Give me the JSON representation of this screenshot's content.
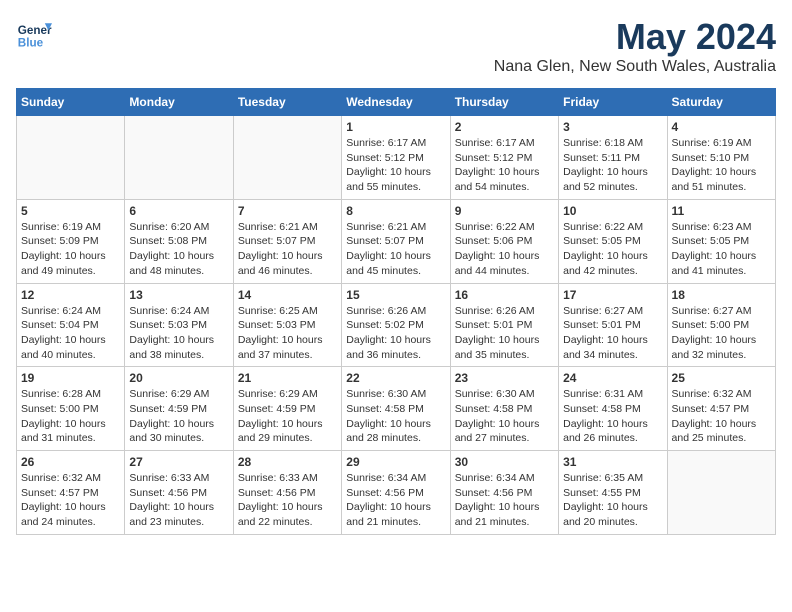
{
  "header": {
    "logo_line1": "General",
    "logo_line2": "Blue",
    "month_year": "May 2024",
    "location": "Nana Glen, New South Wales, Australia"
  },
  "days_of_week": [
    "Sunday",
    "Monday",
    "Tuesday",
    "Wednesday",
    "Thursday",
    "Friday",
    "Saturday"
  ],
  "weeks": [
    [
      {
        "day": "",
        "info": ""
      },
      {
        "day": "",
        "info": ""
      },
      {
        "day": "",
        "info": ""
      },
      {
        "day": "1",
        "info": "Sunrise: 6:17 AM\nSunset: 5:12 PM\nDaylight: 10 hours\nand 55 minutes."
      },
      {
        "day": "2",
        "info": "Sunrise: 6:17 AM\nSunset: 5:12 PM\nDaylight: 10 hours\nand 54 minutes."
      },
      {
        "day": "3",
        "info": "Sunrise: 6:18 AM\nSunset: 5:11 PM\nDaylight: 10 hours\nand 52 minutes."
      },
      {
        "day": "4",
        "info": "Sunrise: 6:19 AM\nSunset: 5:10 PM\nDaylight: 10 hours\nand 51 minutes."
      }
    ],
    [
      {
        "day": "5",
        "info": "Sunrise: 6:19 AM\nSunset: 5:09 PM\nDaylight: 10 hours\nand 49 minutes."
      },
      {
        "day": "6",
        "info": "Sunrise: 6:20 AM\nSunset: 5:08 PM\nDaylight: 10 hours\nand 48 minutes."
      },
      {
        "day": "7",
        "info": "Sunrise: 6:21 AM\nSunset: 5:07 PM\nDaylight: 10 hours\nand 46 minutes."
      },
      {
        "day": "8",
        "info": "Sunrise: 6:21 AM\nSunset: 5:07 PM\nDaylight: 10 hours\nand 45 minutes."
      },
      {
        "day": "9",
        "info": "Sunrise: 6:22 AM\nSunset: 5:06 PM\nDaylight: 10 hours\nand 44 minutes."
      },
      {
        "day": "10",
        "info": "Sunrise: 6:22 AM\nSunset: 5:05 PM\nDaylight: 10 hours\nand 42 minutes."
      },
      {
        "day": "11",
        "info": "Sunrise: 6:23 AM\nSunset: 5:05 PM\nDaylight: 10 hours\nand 41 minutes."
      }
    ],
    [
      {
        "day": "12",
        "info": "Sunrise: 6:24 AM\nSunset: 5:04 PM\nDaylight: 10 hours\nand 40 minutes."
      },
      {
        "day": "13",
        "info": "Sunrise: 6:24 AM\nSunset: 5:03 PM\nDaylight: 10 hours\nand 38 minutes."
      },
      {
        "day": "14",
        "info": "Sunrise: 6:25 AM\nSunset: 5:03 PM\nDaylight: 10 hours\nand 37 minutes."
      },
      {
        "day": "15",
        "info": "Sunrise: 6:26 AM\nSunset: 5:02 PM\nDaylight: 10 hours\nand 36 minutes."
      },
      {
        "day": "16",
        "info": "Sunrise: 6:26 AM\nSunset: 5:01 PM\nDaylight: 10 hours\nand 35 minutes."
      },
      {
        "day": "17",
        "info": "Sunrise: 6:27 AM\nSunset: 5:01 PM\nDaylight: 10 hours\nand 34 minutes."
      },
      {
        "day": "18",
        "info": "Sunrise: 6:27 AM\nSunset: 5:00 PM\nDaylight: 10 hours\nand 32 minutes."
      }
    ],
    [
      {
        "day": "19",
        "info": "Sunrise: 6:28 AM\nSunset: 5:00 PM\nDaylight: 10 hours\nand 31 minutes."
      },
      {
        "day": "20",
        "info": "Sunrise: 6:29 AM\nSunset: 4:59 PM\nDaylight: 10 hours\nand 30 minutes."
      },
      {
        "day": "21",
        "info": "Sunrise: 6:29 AM\nSunset: 4:59 PM\nDaylight: 10 hours\nand 29 minutes."
      },
      {
        "day": "22",
        "info": "Sunrise: 6:30 AM\nSunset: 4:58 PM\nDaylight: 10 hours\nand 28 minutes."
      },
      {
        "day": "23",
        "info": "Sunrise: 6:30 AM\nSunset: 4:58 PM\nDaylight: 10 hours\nand 27 minutes."
      },
      {
        "day": "24",
        "info": "Sunrise: 6:31 AM\nSunset: 4:58 PM\nDaylight: 10 hours\nand 26 minutes."
      },
      {
        "day": "25",
        "info": "Sunrise: 6:32 AM\nSunset: 4:57 PM\nDaylight: 10 hours\nand 25 minutes."
      }
    ],
    [
      {
        "day": "26",
        "info": "Sunrise: 6:32 AM\nSunset: 4:57 PM\nDaylight: 10 hours\nand 24 minutes."
      },
      {
        "day": "27",
        "info": "Sunrise: 6:33 AM\nSunset: 4:56 PM\nDaylight: 10 hours\nand 23 minutes."
      },
      {
        "day": "28",
        "info": "Sunrise: 6:33 AM\nSunset: 4:56 PM\nDaylight: 10 hours\nand 22 minutes."
      },
      {
        "day": "29",
        "info": "Sunrise: 6:34 AM\nSunset: 4:56 PM\nDaylight: 10 hours\nand 21 minutes."
      },
      {
        "day": "30",
        "info": "Sunrise: 6:34 AM\nSunset: 4:56 PM\nDaylight: 10 hours\nand 21 minutes."
      },
      {
        "day": "31",
        "info": "Sunrise: 6:35 AM\nSunset: 4:55 PM\nDaylight: 10 hours\nand 20 minutes."
      },
      {
        "day": "",
        "info": ""
      }
    ]
  ]
}
